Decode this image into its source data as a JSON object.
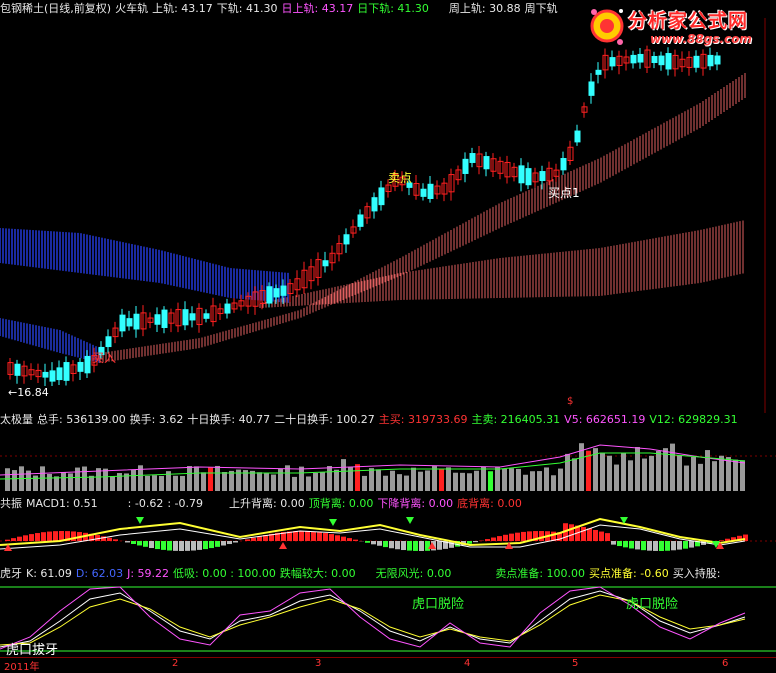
{
  "header": {
    "stock": "包钢稀土(日线,前复权)",
    "indicator": "火车轨",
    "upper": "上轨: 43.17",
    "lower": "下轨: 41.30",
    "day_upper": "日上轨: 43.17",
    "day_lower": "日下轨: 41.30",
    "week_upper": "周上轨: 30.88",
    "week_lower": "周下轨"
  },
  "logo": {
    "title": "分析家公式网",
    "url": "www.88gs.com"
  },
  "main_labels": {
    "low_price": "←16.84",
    "buy": "买入",
    "sell": "卖点",
    "buy1": "买点1",
    "dollar": "$"
  },
  "volume_header": {
    "name": "太极量",
    "total": "总手: 536139.00",
    "turnover": "换手: 3.62",
    "ten_day": "十日换手: 40.77",
    "twenty_day": "二十日换手: 100.27",
    "main_buy": "主买: 319733.69",
    "main_sell": "主卖: 216405.31",
    "v5": "V5: 662651.19",
    "v12": "V12: 629829.31"
  },
  "macd_header": {
    "name": "共振",
    "macd1": "MACD1: 0.51",
    "v1": ": -0.62",
    "v2": ": -0.79",
    "rise_div": "上升背离: 0.00",
    "top_div": "顶背离: 0.00",
    "fall_div": "下降背离: 0.00",
    "bottom_div": "底背离: 0.00"
  },
  "kdj_header": {
    "name": "虎牙",
    "k": "K: 61.09",
    "d": "D: 62.03",
    "j": "J: 59.22",
    "absorb": "低吸: 0.00 : 100.00",
    "big_swing": "跌幅较大: 0.00",
    "no_risk": "无限风光: 0.00",
    "sell_ready": "卖点准备: 100.00",
    "buy_ready": "买点准备: -0.60",
    "buy_hold": "买入持股:"
  },
  "kdj_labels": {
    "escape1": "虎口脱险",
    "escape2": "虎口脱险",
    "pull_tooth": "虎口拔牙"
  },
  "xaxis": {
    "year": "2011年",
    "m2": "2",
    "m3": "3",
    "m4": "4",
    "m5": "5",
    "m6": "6"
  },
  "colors": {
    "up": "#ff2020",
    "down": "#33ffff",
    "rail": "#e06060",
    "cloud": "#1a2aa0",
    "kline": "#ffffff",
    "dline": "#ffff33",
    "jline": "#ff55ff"
  }
}
